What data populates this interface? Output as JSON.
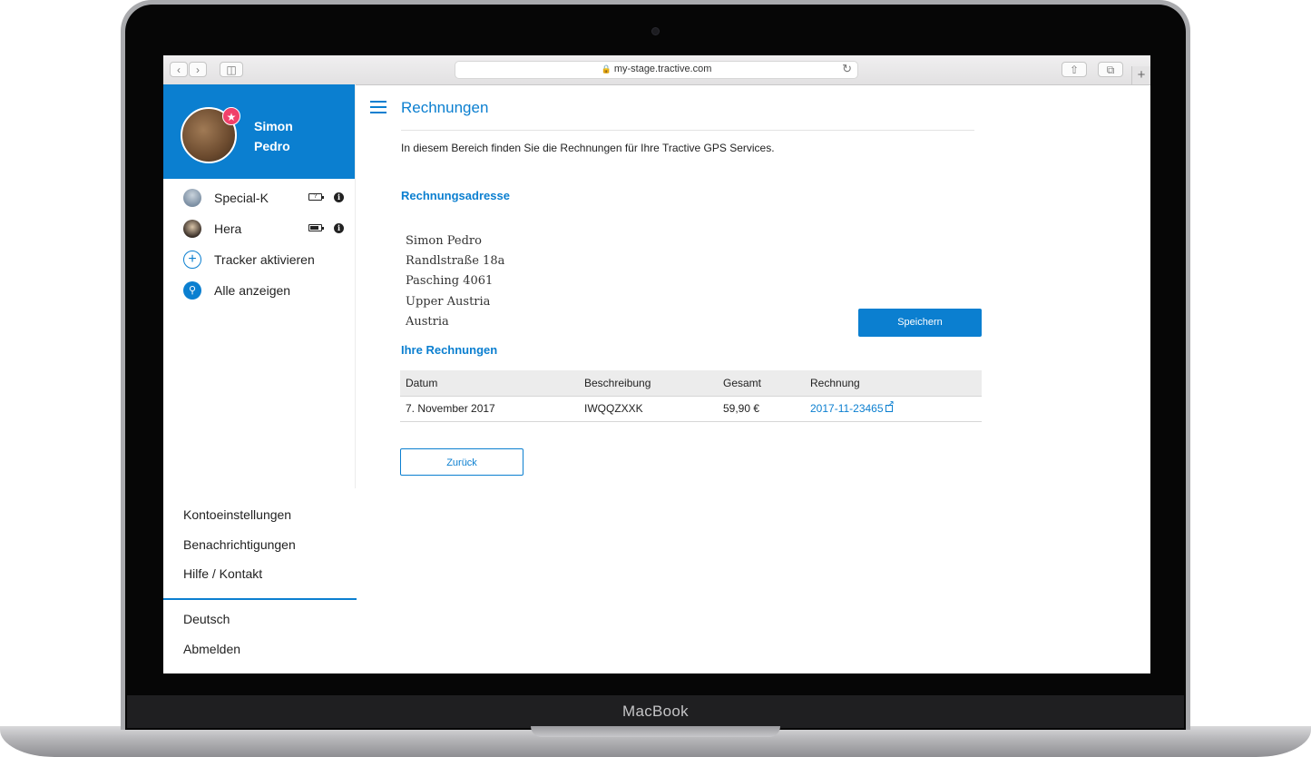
{
  "device": {
    "label": "MacBook"
  },
  "browser": {
    "url": "my-stage.tractive.com",
    "back_icon": "chevron-left",
    "forward_icon": "chevron-right",
    "sidebar_icon": "sidebar",
    "reload_icon": "reload",
    "share_icon": "share",
    "tabs_icon": "tabs",
    "new_tab_icon": "plus"
  },
  "sidebar": {
    "user_first": "Simon",
    "user_last": "Pedro",
    "badge_icon": "star",
    "pets": [
      {
        "name": "Special-K",
        "battery": "?",
        "battery_level": 0,
        "info": "i"
      },
      {
        "name": "Hera",
        "battery": "",
        "battery_level": 0.85,
        "info": "i"
      }
    ],
    "activate_label": "Tracker aktivieren",
    "activate_icon": "+",
    "show_all_label": "Alle anzeigen",
    "show_all_icon": "pin",
    "links": [
      "Kontoeinstellungen",
      "Benachrichtigungen",
      "Hilfe / Kontakt"
    ],
    "language": "Deutsch",
    "logout": "Abmelden"
  },
  "main": {
    "title": "Rechnungen",
    "intro": "In diesem Bereich finden Sie die Rechnungen für Ihre Tractive GPS Services.",
    "address_title": "Rechnungsadresse",
    "address": [
      "Simon Pedro",
      "Randlstraße 18a",
      "Pasching 4061",
      "Upper Austria",
      "Austria"
    ],
    "save_label": "Speichern",
    "invoices_title": "Ihre Rechnungen",
    "table": {
      "headers": [
        "Datum",
        "Beschreibung",
        "Gesamt",
        "Rechnung"
      ],
      "rows": [
        {
          "date": "7. November 2017",
          "description": "IWQQZXXK",
          "total": "59,90 €",
          "invoice": "2017-11-23465"
        }
      ]
    },
    "back_label": "Zurück"
  },
  "colors": {
    "accent": "#0b7fd0",
    "badge": "#f0406a"
  }
}
